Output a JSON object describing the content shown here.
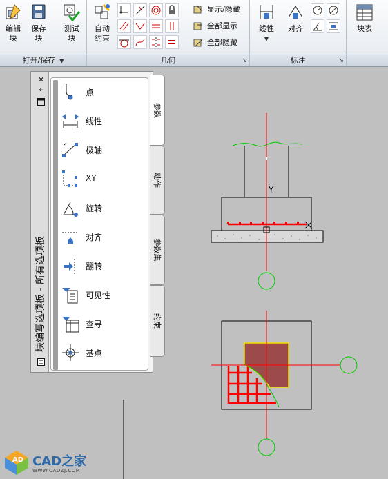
{
  "ribbon": {
    "groups": [
      {
        "title": "打开/保存",
        "has_dropdown": true
      },
      {
        "title": "几何",
        "has_launcher": true
      },
      {
        "title": "标注",
        "has_launcher": true
      }
    ],
    "buttons": {
      "edit_block": "编辑\n块",
      "save_block": "保存\n块",
      "test_block": "测试\n块",
      "auto_constrain": "自动\n约束",
      "linear": "线性",
      "aligned": "对齐",
      "block_table": "块表"
    },
    "text_buttons": {
      "show_hide": "显示/隐藏",
      "show_all": "全部显示",
      "hide_all": "全部隐藏"
    }
  },
  "palette": {
    "title": "块编写选项板 - 所有选项板",
    "tabs": [
      "参数",
      "动作",
      "参数集",
      "约束"
    ],
    "active_tab": "参数",
    "tools": [
      {
        "label": "点",
        "icon": "point-parameter-icon"
      },
      {
        "label": "线性",
        "icon": "linear-parameter-icon"
      },
      {
        "label": "极轴",
        "icon": "polar-parameter-icon"
      },
      {
        "label": "XY",
        "icon": "xy-parameter-icon"
      },
      {
        "label": "旋转",
        "icon": "rotation-parameter-icon"
      },
      {
        "label": "对齐",
        "icon": "alignment-parameter-icon"
      },
      {
        "label": "翻转",
        "icon": "flip-parameter-icon"
      },
      {
        "label": "可见性",
        "icon": "visibility-parameter-icon"
      },
      {
        "label": "查寻",
        "icon": "lookup-parameter-icon"
      },
      {
        "label": "基点",
        "icon": "base-point-parameter-icon"
      }
    ]
  },
  "drawing": {
    "label_y": "Y"
  },
  "watermark": {
    "text": "CAD之家",
    "url": "WWW.CADZJ.COM"
  },
  "colors": {
    "background": "#c0c0c0",
    "axis_red": "#ff0000",
    "grip_green": "#00cc00",
    "hatch_fill": "#9c4a4a",
    "outline_yellow": "#f0e000"
  }
}
